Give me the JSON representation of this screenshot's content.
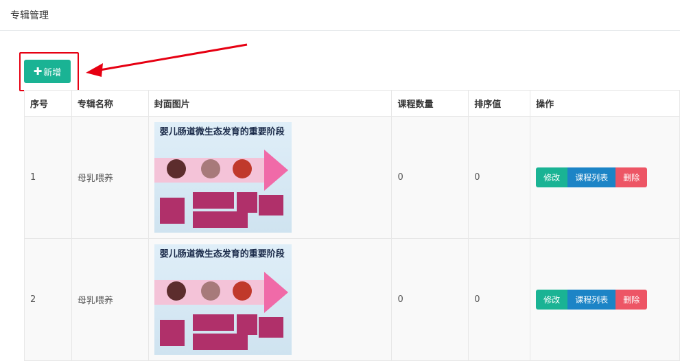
{
  "page": {
    "title": "专辑管理"
  },
  "toolbar": {
    "add_label": "新增",
    "add_icon": "plus-icon"
  },
  "table": {
    "headers": [
      "序号",
      "专辑名称",
      "封面图片",
      "课程数量",
      "排序值",
      "操作"
    ],
    "rows": [
      {
        "index": "1",
        "name": "母乳喂养",
        "cover_title": "婴儿肠道微生态发育的重要阶段",
        "course_count": "0",
        "sort_value": "0"
      },
      {
        "index": "2",
        "name": "母乳喂养",
        "cover_title": "婴儿肠道微生态发育的重要阶段",
        "course_count": "0",
        "sort_value": "0"
      }
    ],
    "actions": {
      "edit": "修改",
      "course_list": "课程列表",
      "delete": "删除"
    }
  },
  "colors": {
    "primary": "#1ab394",
    "info": "#1c84c6",
    "danger": "#ed5565",
    "highlight": "#e60012"
  }
}
